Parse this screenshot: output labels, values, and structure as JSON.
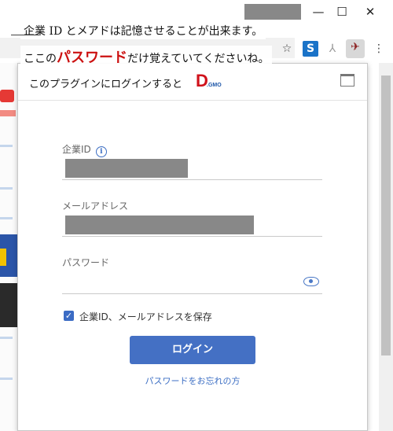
{
  "window": {
    "minimize_glyph": "—",
    "maximize_glyph": "☐",
    "close_glyph": "✕"
  },
  "toolbar": {
    "star_glyph": "☆",
    "ext_s_glyph": "S",
    "ext_a_glyph": "⅄",
    "ext_active_glyph": "✈",
    "menu_glyph": "⋮"
  },
  "annotation": {
    "line1": "企業 ID とメアドは記憶させることが出来ます。",
    "line2_prefix": "ここの",
    "line2_highlight": "パスワード",
    "line2_suffix": "だけ覚えていてくださいね。"
  },
  "popup": {
    "header_text": "このプラグインにログインすると",
    "logo_letter": "D",
    "logo_sub": ".GMO",
    "company_label": "企業ID",
    "info_glyph": "i",
    "email_label": "メールアドレス",
    "password_label": "パスワード",
    "save_checkbox_glyph": "✓",
    "save_label": "企業ID、メールアドレスを保存",
    "login_button": "ログイン",
    "forgot_link": "パスワードをお忘れの方"
  },
  "colors": {
    "accent": "#4470c4",
    "brand_red": "#d0121b",
    "annotation_red": "#cc1111"
  }
}
